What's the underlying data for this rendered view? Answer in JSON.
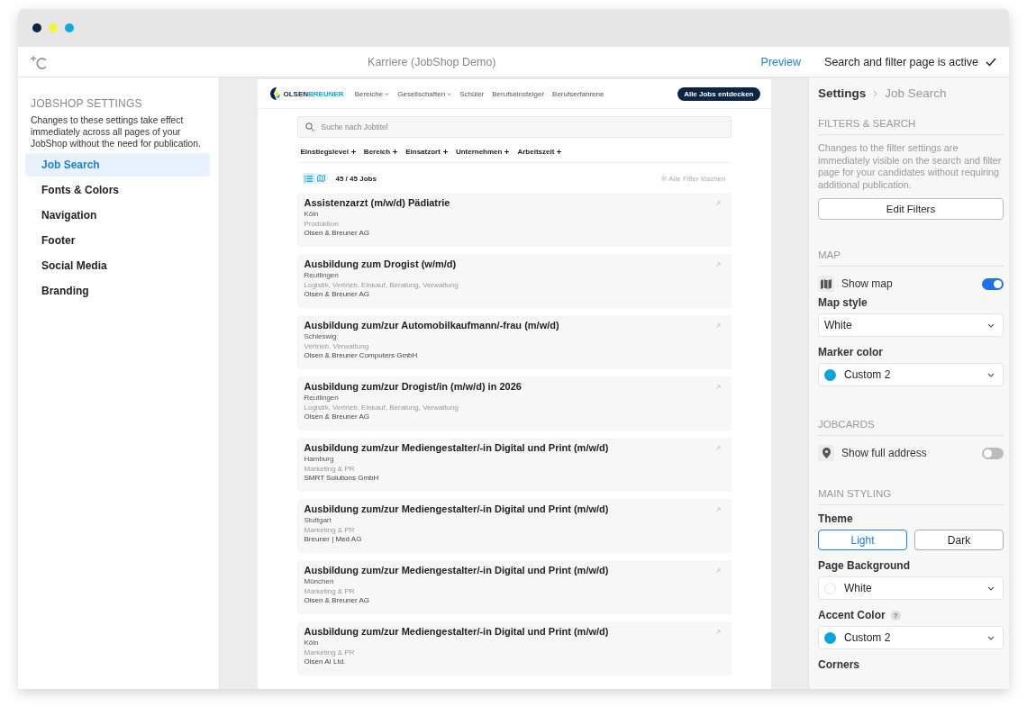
{
  "window": {
    "controls": [
      {
        "color": "#0b2545"
      },
      {
        "color": "#eef53a"
      },
      {
        "color": "#10a9dc"
      }
    ],
    "title": "Karriere (JobShop Demo)",
    "preview_link": "Preview",
    "status": "Search and filter page is active"
  },
  "sidebar": {
    "heading": "JOBSHOP SETTINGS",
    "description": "Changes to these settings take effect immediately across all pages of your JobShop without the need for publication.",
    "items": [
      {
        "label": "Job Search",
        "selected": true
      },
      {
        "label": "Fonts & Colors",
        "selected": false
      },
      {
        "label": "Navigation",
        "selected": false
      },
      {
        "label": "Footer",
        "selected": false
      },
      {
        "label": "Social Media",
        "selected": false
      },
      {
        "label": "Branding",
        "selected": false
      }
    ]
  },
  "preview": {
    "nav": {
      "logo_first": "OLSEN",
      "logo_second": "BREUNER",
      "links": [
        {
          "label": "Bereiche",
          "dropdown": true
        },
        {
          "label": "Gesellschaften",
          "dropdown": true
        },
        {
          "label": "Schüler",
          "dropdown": false
        },
        {
          "label": "Berufseinsteiger",
          "dropdown": false
        },
        {
          "label": "Berufserfahrene",
          "dropdown": false
        }
      ],
      "cta": "Alle Jobs entdecken"
    },
    "search": {
      "placeholder": "Suche nach Jobtitel"
    },
    "filters": [
      "Einstiegslevel",
      "Bereich",
      "Einsatzort",
      "Unternehmen",
      "Arbeitszeit"
    ],
    "views": [
      {
        "kind": "list",
        "selected": true
      },
      {
        "kind": "map",
        "selected": false
      }
    ],
    "count": "45 / 45 Jobs",
    "clear": "Alle Filter löschen",
    "jobs": [
      {
        "title": "Assistenzarzt (m/w/d) Pädiatrie",
        "location": "Köln",
        "categories": "Produktion",
        "company": "Olsen & Breuner AG"
      },
      {
        "title": "Ausbildung zum Drogist (w/m/d)",
        "location": "Reutlingen",
        "categories": "Logistik, Vertrieb, Einkauf, Beratung, Verwaltung",
        "company": "Olsen & Breuner AG"
      },
      {
        "title": "Ausbildung zum/zur Automobilkaufmann/-frau (m/w/d)",
        "location": "Schleswig",
        "categories": "Vertrieb, Verwaltung",
        "company": "Olsen & Breuner Computers GmbH"
      },
      {
        "title": "Ausbildung zum/zur Drogist/in (m/w/d) in 2026",
        "location": "Reutlingen",
        "categories": "Logistik, Vertrieb, Einkauf, Beratung, Verwaltung",
        "company": "Olsen & Breuner AG"
      },
      {
        "title": "Ausbildung zum/zur Mediengestalter/-in Digital und Print (m/w/d)",
        "location": "Hamburg",
        "categories": "Marketing & PR",
        "company": "SMRT Solutions GmbH"
      },
      {
        "title": "Ausbildung zum/zur Mediengestalter/-in Digital und Print (m/w/d)",
        "location": "Stuttgart",
        "categories": "Marketing & PR",
        "company": "Breuner | Med AG"
      },
      {
        "title": "Ausbildung zum/zur Mediengestalter/-in Digital und Print (m/w/d)",
        "location": "München",
        "categories": "Marketing & PR",
        "company": "Olsen & Breuner AG"
      },
      {
        "title": "Ausbildung zum/zur Mediengestalter/-in Digital und Print (m/w/d)",
        "location": "Köln",
        "categories": "Marketing & PR",
        "company": "Olsen AI Ltd."
      }
    ]
  },
  "settings": {
    "breadcrumb": [
      "Settings",
      "Job Search"
    ],
    "sections": [
      {
        "heading": "FILTERS & SEARCH",
        "items": [
          {
            "kind": "note",
            "text": "Changes to the filter settings are immediately visible on the search and filter page for your candidates without requiring additional publication."
          },
          {
            "kind": "button",
            "text": "Edit Filters"
          }
        ]
      },
      {
        "heading": "MAP",
        "items": [
          {
            "kind": "toggle",
            "text": "Show map",
            "on": true
          },
          {
            "kind": "label",
            "text": "Map style"
          },
          {
            "kind": "select",
            "value": "White"
          },
          {
            "kind": "label",
            "text": "Marker color"
          },
          {
            "kind": "select",
            "value": "Custom 2",
            "color": "#0aa5d8"
          }
        ]
      },
      {
        "heading": "JOBCARDS",
        "items": [
          {
            "kind": "toggle",
            "text": "Show full address",
            "on": false
          }
        ]
      },
      {
        "heading": "MAIN STYLING",
        "items": [
          {
            "kind": "label",
            "text": "Theme"
          },
          {
            "kind": "segmented",
            "options": [
              {
                "label": "Light",
                "selected": true
              },
              {
                "label": "Dark",
                "selected": false
              }
            ]
          },
          {
            "kind": "label",
            "text": "Page Background"
          },
          {
            "kind": "select",
            "value": "White",
            "color": "#ffffff"
          },
          {
            "kind": "label",
            "text": "Accent Color",
            "help": "?"
          },
          {
            "kind": "select",
            "value": "Custom 2",
            "color": "#0aa5d8"
          },
          {
            "kind": "label",
            "text": "Corners"
          }
        ]
      }
    ]
  }
}
